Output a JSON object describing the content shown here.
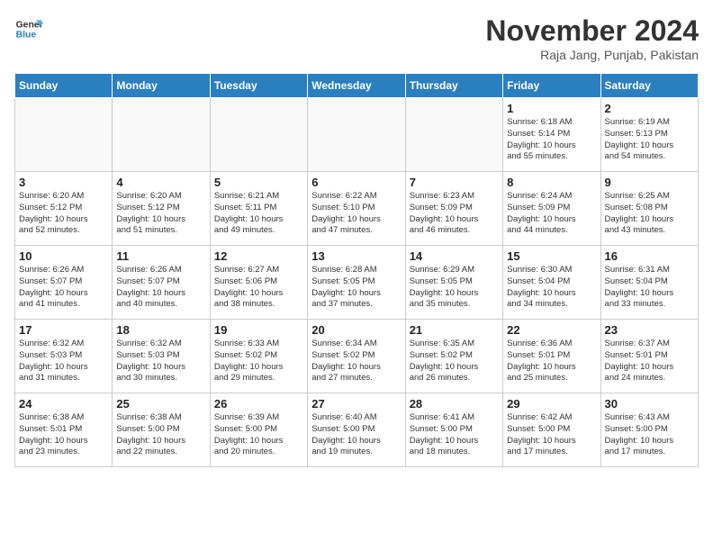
{
  "header": {
    "logo_general": "General",
    "logo_blue": "Blue",
    "month_title": "November 2024",
    "location": "Raja Jang, Punjab, Pakistan"
  },
  "weekdays": [
    "Sunday",
    "Monday",
    "Tuesday",
    "Wednesday",
    "Thursday",
    "Friday",
    "Saturday"
  ],
  "weeks": [
    [
      {
        "day": "",
        "info": ""
      },
      {
        "day": "",
        "info": ""
      },
      {
        "day": "",
        "info": ""
      },
      {
        "day": "",
        "info": ""
      },
      {
        "day": "",
        "info": ""
      },
      {
        "day": "1",
        "info": "Sunrise: 6:18 AM\nSunset: 5:14 PM\nDaylight: 10 hours\nand 55 minutes."
      },
      {
        "day": "2",
        "info": "Sunrise: 6:19 AM\nSunset: 5:13 PM\nDaylight: 10 hours\nand 54 minutes."
      }
    ],
    [
      {
        "day": "3",
        "info": "Sunrise: 6:20 AM\nSunset: 5:12 PM\nDaylight: 10 hours\nand 52 minutes."
      },
      {
        "day": "4",
        "info": "Sunrise: 6:20 AM\nSunset: 5:12 PM\nDaylight: 10 hours\nand 51 minutes."
      },
      {
        "day": "5",
        "info": "Sunrise: 6:21 AM\nSunset: 5:11 PM\nDaylight: 10 hours\nand 49 minutes."
      },
      {
        "day": "6",
        "info": "Sunrise: 6:22 AM\nSunset: 5:10 PM\nDaylight: 10 hours\nand 47 minutes."
      },
      {
        "day": "7",
        "info": "Sunrise: 6:23 AM\nSunset: 5:09 PM\nDaylight: 10 hours\nand 46 minutes."
      },
      {
        "day": "8",
        "info": "Sunrise: 6:24 AM\nSunset: 5:09 PM\nDaylight: 10 hours\nand 44 minutes."
      },
      {
        "day": "9",
        "info": "Sunrise: 6:25 AM\nSunset: 5:08 PM\nDaylight: 10 hours\nand 43 minutes."
      }
    ],
    [
      {
        "day": "10",
        "info": "Sunrise: 6:26 AM\nSunset: 5:07 PM\nDaylight: 10 hours\nand 41 minutes."
      },
      {
        "day": "11",
        "info": "Sunrise: 6:26 AM\nSunset: 5:07 PM\nDaylight: 10 hours\nand 40 minutes."
      },
      {
        "day": "12",
        "info": "Sunrise: 6:27 AM\nSunset: 5:06 PM\nDaylight: 10 hours\nand 38 minutes."
      },
      {
        "day": "13",
        "info": "Sunrise: 6:28 AM\nSunset: 5:05 PM\nDaylight: 10 hours\nand 37 minutes."
      },
      {
        "day": "14",
        "info": "Sunrise: 6:29 AM\nSunset: 5:05 PM\nDaylight: 10 hours\nand 35 minutes."
      },
      {
        "day": "15",
        "info": "Sunrise: 6:30 AM\nSunset: 5:04 PM\nDaylight: 10 hours\nand 34 minutes."
      },
      {
        "day": "16",
        "info": "Sunrise: 6:31 AM\nSunset: 5:04 PM\nDaylight: 10 hours\nand 33 minutes."
      }
    ],
    [
      {
        "day": "17",
        "info": "Sunrise: 6:32 AM\nSunset: 5:03 PM\nDaylight: 10 hours\nand 31 minutes."
      },
      {
        "day": "18",
        "info": "Sunrise: 6:32 AM\nSunset: 5:03 PM\nDaylight: 10 hours\nand 30 minutes."
      },
      {
        "day": "19",
        "info": "Sunrise: 6:33 AM\nSunset: 5:02 PM\nDaylight: 10 hours\nand 29 minutes."
      },
      {
        "day": "20",
        "info": "Sunrise: 6:34 AM\nSunset: 5:02 PM\nDaylight: 10 hours\nand 27 minutes."
      },
      {
        "day": "21",
        "info": "Sunrise: 6:35 AM\nSunset: 5:02 PM\nDaylight: 10 hours\nand 26 minutes."
      },
      {
        "day": "22",
        "info": "Sunrise: 6:36 AM\nSunset: 5:01 PM\nDaylight: 10 hours\nand 25 minutes."
      },
      {
        "day": "23",
        "info": "Sunrise: 6:37 AM\nSunset: 5:01 PM\nDaylight: 10 hours\nand 24 minutes."
      }
    ],
    [
      {
        "day": "24",
        "info": "Sunrise: 6:38 AM\nSunset: 5:01 PM\nDaylight: 10 hours\nand 23 minutes."
      },
      {
        "day": "25",
        "info": "Sunrise: 6:38 AM\nSunset: 5:00 PM\nDaylight: 10 hours\nand 22 minutes."
      },
      {
        "day": "26",
        "info": "Sunrise: 6:39 AM\nSunset: 5:00 PM\nDaylight: 10 hours\nand 20 minutes."
      },
      {
        "day": "27",
        "info": "Sunrise: 6:40 AM\nSunset: 5:00 PM\nDaylight: 10 hours\nand 19 minutes."
      },
      {
        "day": "28",
        "info": "Sunrise: 6:41 AM\nSunset: 5:00 PM\nDaylight: 10 hours\nand 18 minutes."
      },
      {
        "day": "29",
        "info": "Sunrise: 6:42 AM\nSunset: 5:00 PM\nDaylight: 10 hours\nand 17 minutes."
      },
      {
        "day": "30",
        "info": "Sunrise: 6:43 AM\nSunset: 5:00 PM\nDaylight: 10 hours\nand 17 minutes."
      }
    ]
  ]
}
